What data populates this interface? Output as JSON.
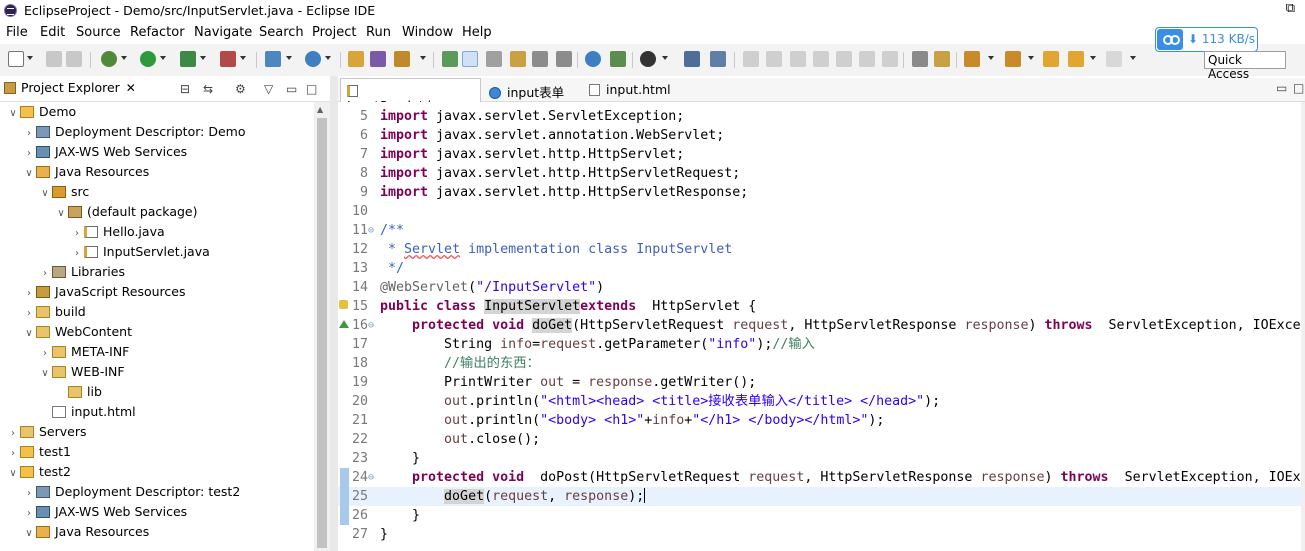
{
  "window": {
    "title": "EclipseProject - Demo/src/InputServlet.java - Eclipse IDE",
    "restore_glyph": "⧉"
  },
  "menu": [
    "File",
    "Edit",
    "Source",
    "Refactor",
    "Navigate",
    "Search",
    "Project",
    "Run",
    "Window",
    "Help"
  ],
  "net_monitor": {
    "speed": "113 KB/s",
    "arrow": "⬇"
  },
  "quick_access": {
    "placeholder": "Quick Access"
  },
  "project_explorer": {
    "tab_label": "Project Explorer",
    "close_glyph": "✕",
    "tree": [
      {
        "label": "Demo",
        "depth": 0,
        "toggle": "expanded",
        "icon": "project-icon"
      },
      {
        "label": "Deployment Descriptor: Demo",
        "depth": 1,
        "toggle": "collapsed",
        "icon": "deployment-descriptor-icon"
      },
      {
        "label": "JAX-WS Web Services",
        "depth": 1,
        "toggle": "collapsed",
        "icon": "jaxws-icon"
      },
      {
        "label": "Java Resources",
        "depth": 1,
        "toggle": "expanded",
        "icon": "java-resources-icon"
      },
      {
        "label": "src",
        "depth": 2,
        "toggle": "expanded",
        "icon": "source-folder-icon"
      },
      {
        "label": "(default package)",
        "depth": 3,
        "toggle": "expanded",
        "icon": "package-icon"
      },
      {
        "label": "Hello.java",
        "depth": 4,
        "toggle": "collapsed",
        "icon": "java-file-icon"
      },
      {
        "label": "InputServlet.java",
        "depth": 4,
        "toggle": "collapsed",
        "icon": "java-file-icon"
      },
      {
        "label": "Libraries",
        "depth": 2,
        "toggle": "collapsed",
        "icon": "libraries-icon"
      },
      {
        "label": "JavaScript Resources",
        "depth": 1,
        "toggle": "collapsed",
        "icon": "javascript-resources-icon"
      },
      {
        "label": "build",
        "depth": 1,
        "toggle": "collapsed",
        "icon": "folder-icon"
      },
      {
        "label": "WebContent",
        "depth": 1,
        "toggle": "expanded",
        "icon": "folder-icon"
      },
      {
        "label": "META-INF",
        "depth": 2,
        "toggle": "collapsed",
        "icon": "folder-icon"
      },
      {
        "label": "WEB-INF",
        "depth": 2,
        "toggle": "expanded",
        "icon": "folder-icon"
      },
      {
        "label": "lib",
        "depth": 3,
        "toggle": "none",
        "icon": "folder-icon"
      },
      {
        "label": "input.html",
        "depth": 2,
        "toggle": "none",
        "icon": "html-file-icon"
      },
      {
        "label": "Servers",
        "depth": 0,
        "toggle": "collapsed",
        "icon": "folder-icon"
      },
      {
        "label": "test1",
        "depth": 0,
        "toggle": "collapsed",
        "icon": "project-icon"
      },
      {
        "label": "test2",
        "depth": 0,
        "toggle": "expanded",
        "icon": "project-icon"
      },
      {
        "label": "Deployment Descriptor: test2",
        "depth": 1,
        "toggle": "collapsed",
        "icon": "deployment-descriptor-icon"
      },
      {
        "label": "JAX-WS Web Services",
        "depth": 1,
        "toggle": "collapsed",
        "icon": "jaxws-icon"
      },
      {
        "label": "Java Resources",
        "depth": 1,
        "toggle": "expanded",
        "icon": "java-resources-icon"
      }
    ]
  },
  "editor": {
    "tabs": [
      {
        "label": "InputServlet.java",
        "active": true,
        "icon": "java-file-icon",
        "closable": true
      },
      {
        "label": "input表单",
        "active": false,
        "icon": "globe-icon",
        "closable": false
      },
      {
        "label": "input.html",
        "active": false,
        "icon": "html-file-icon",
        "closable": false
      }
    ],
    "close_glyph": "✕",
    "lines": [
      {
        "n": "5",
        "tokens": [
          [
            "kw",
            "import"
          ],
          [
            "",
            "javax.servlet.ServletException;"
          ]
        ]
      },
      {
        "n": "6",
        "tokens": [
          [
            "kw",
            "import"
          ],
          [
            "",
            "javax.servlet.annotation.WebServlet;"
          ]
        ]
      },
      {
        "n": "7",
        "tokens": [
          [
            "kw",
            "import"
          ],
          [
            "",
            "javax.servlet.http.HttpServlet;"
          ]
        ]
      },
      {
        "n": "8",
        "tokens": [
          [
            "kw",
            "import"
          ],
          [
            "",
            "javax.servlet.http.HttpServletRequest;"
          ]
        ]
      },
      {
        "n": "9",
        "tokens": [
          [
            "kw",
            "import"
          ],
          [
            "",
            "javax.servlet.http.HttpServletResponse;"
          ]
        ]
      },
      {
        "n": "10",
        "tokens": []
      },
      {
        "n": "11",
        "fold": "⊖",
        "tokens": [
          [
            "jd",
            "/**"
          ]
        ]
      },
      {
        "n": "12",
        "tokens": [
          [
            "jd",
            " * "
          ],
          [
            "jd spell",
            "Servlet"
          ],
          [
            "jd",
            " implementation class InputServlet"
          ]
        ]
      },
      {
        "n": "13",
        "tokens": [
          [
            "jd",
            " */"
          ]
        ]
      },
      {
        "n": "14",
        "tokens": [
          [
            "ann",
            "@WebServlet"
          ],
          [
            "",
            "("
          ],
          [
            "str",
            "\"/InputServlet\""
          ],
          [
            "",
            ")"
          ]
        ]
      },
      {
        "n": "15",
        "marker": "warning",
        "tokens": [
          [
            "kw",
            "public class"
          ],
          [
            "",
            ""
          ],
          [
            "hl",
            "InputServlet"
          ],
          [
            "",
            ""
          ],
          [
            "kw",
            "extends"
          ],
          [
            "",
            " HttpServlet {"
          ]
        ]
      },
      {
        "n": "16",
        "fold": "⊖",
        "marker": "override",
        "tokens": [
          [
            "",
            "    "
          ],
          [
            "kw",
            "protected void"
          ],
          [
            "",
            ""
          ],
          [
            "hl",
            "doGet"
          ],
          [
            "",
            "(HttpServletRequest "
          ],
          [
            "var",
            "request"
          ],
          [
            "",
            ", HttpServletResponse "
          ],
          [
            "var",
            "response"
          ],
          [
            "",
            ") "
          ],
          [
            "kw",
            "throws"
          ],
          [
            "",
            " ServletException, IOExcep"
          ]
        ]
      },
      {
        "n": "17",
        "tokens": [
          [
            "",
            "        String "
          ],
          [
            "var",
            "info"
          ],
          [
            "",
            "="
          ],
          [
            "var",
            "request"
          ],
          [
            "",
            ".getParameter("
          ],
          [
            "str",
            "\"info\""
          ],
          [
            "",
            ");"
          ],
          [
            "cm",
            "//输入"
          ]
        ]
      },
      {
        "n": "18",
        "tokens": [
          [
            "",
            "        "
          ],
          [
            "cm",
            "//输出的东西："
          ]
        ]
      },
      {
        "n": "19",
        "tokens": [
          [
            "",
            "        PrintWriter "
          ],
          [
            "var",
            "out"
          ],
          [
            "",
            " = "
          ],
          [
            "var",
            "response"
          ],
          [
            "",
            ".getWriter();"
          ]
        ]
      },
      {
        "n": "20",
        "tokens": [
          [
            "",
            "        "
          ],
          [
            "var",
            "out"
          ],
          [
            "",
            ".println("
          ],
          [
            "str",
            "\"<html><head> <title>接收表单输入</title> </head>\""
          ],
          [
            "",
            ");"
          ]
        ]
      },
      {
        "n": "21",
        "tokens": [
          [
            "",
            "        "
          ],
          [
            "var",
            "out"
          ],
          [
            "",
            ".println("
          ],
          [
            "str",
            "\"<body> <h1>\""
          ],
          [
            "",
            "+"
          ],
          [
            "var",
            "info"
          ],
          [
            "",
            "+"
          ],
          [
            "str",
            "\"</h1> </body></html>\""
          ],
          [
            "",
            ");"
          ]
        ]
      },
      {
        "n": "22",
        "tokens": [
          [
            "",
            "        "
          ],
          [
            "var",
            "out"
          ],
          [
            "",
            ".close();"
          ]
        ]
      },
      {
        "n": "23",
        "tokens": [
          [
            "",
            "    }"
          ]
        ]
      },
      {
        "n": "24",
        "fold": "⊖",
        "marker": "quickdiff",
        "tokens": [
          [
            "",
            "    "
          ],
          [
            "kw",
            "protected void"
          ],
          [
            "",
            " doPost(HttpServletRequest "
          ],
          [
            "var",
            "request"
          ],
          [
            "",
            ", HttpServletResponse "
          ],
          [
            "var",
            "response"
          ],
          [
            "",
            ") "
          ],
          [
            "kw",
            "throws"
          ],
          [
            "",
            " ServletException, IOExce"
          ]
        ]
      },
      {
        "n": "25",
        "current": true,
        "marker": "quickdiff",
        "tokens": [
          [
            "",
            "        "
          ],
          [
            "hl",
            "doGet"
          ],
          [
            "",
            "("
          ],
          [
            "var",
            "request"
          ],
          [
            "",
            ", "
          ],
          [
            "var",
            "response"
          ],
          [
            "",
            ");"
          ],
          [
            "caret",
            ""
          ]
        ]
      },
      {
        "n": "26",
        "marker": "quickdiff",
        "tokens": [
          [
            "",
            "    }"
          ]
        ]
      },
      {
        "n": "27",
        "tokens": [
          [
            "",
            "}"
          ]
        ]
      }
    ]
  }
}
